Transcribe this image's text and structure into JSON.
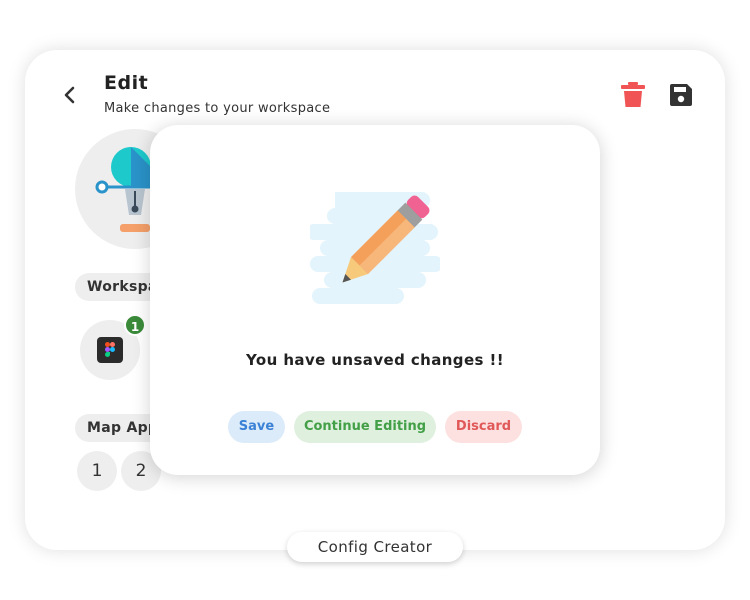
{
  "header": {
    "title": "Edit",
    "subtitle": "Make changes to your workspace",
    "back_icon": "chevron-left-icon",
    "delete_icon": "trash-icon",
    "save_icon": "floppy-disk-icon"
  },
  "sections": {
    "workspace_label": "Workspace",
    "map_apps_label": "Map Apps"
  },
  "workspace_apps": [
    {
      "icon": "figma-icon",
      "badge_count": "1"
    }
  ],
  "map_apps": [
    "1",
    "2"
  ],
  "bottom_tab": {
    "label": "Config Creator"
  },
  "modal": {
    "illustration": "pencil-icon",
    "message": "You have unsaved changes !!",
    "save_label": "Save",
    "continue_label": "Continue Editing",
    "discard_label": "Discard"
  },
  "colors": {
    "delete_icon": "#f05454",
    "save_icon": "#333333",
    "badge": "#3a8a3a",
    "save_button_text": "#3b82d6",
    "save_button_bg": "#dcebfa",
    "continue_button_text": "#43a047",
    "continue_button_bg": "#dff0df",
    "discard_button_text": "#e05858",
    "discard_button_bg": "#fde0e0"
  }
}
